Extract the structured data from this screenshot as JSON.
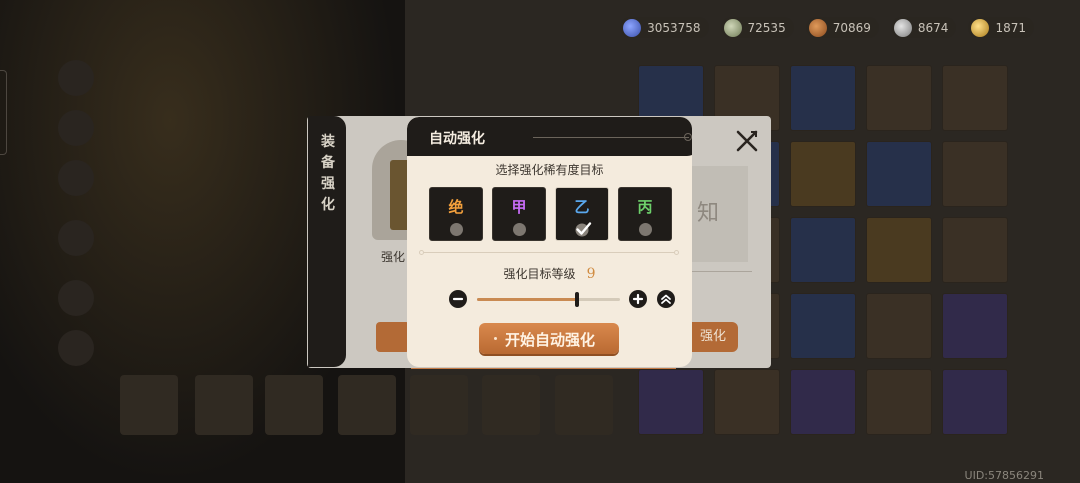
{
  "currencies": [
    {
      "icon": "blue-gem-icon",
      "value": "3053758"
    },
    {
      "icon": "green-leaf-icon",
      "value": "72535"
    },
    {
      "icon": "copper-ore-icon",
      "value": "70869"
    },
    {
      "icon": "silver-ore-icon",
      "value": "8674"
    },
    {
      "icon": "gold-coin-icon",
      "value": "1871"
    }
  ],
  "uid": "UID:57856291",
  "parent_dialog": {
    "tab_title": "装备强化",
    "left_label": "强化",
    "unknown_text": "知",
    "right_button": "强化"
  },
  "auto_dialog": {
    "title": "自动强化",
    "subtitle": "选择强化稀有度目标",
    "rarities": [
      {
        "name": "绝",
        "color": "#f3a03c",
        "selected": false
      },
      {
        "name": "甲",
        "color": "#c66bf5",
        "selected": false
      },
      {
        "name": "乙",
        "color": "#5aa8ee",
        "selected": true
      },
      {
        "name": "丙",
        "color": "#6dd06b",
        "selected": false
      }
    ],
    "level_label": "强化目标等级",
    "level_value": "9",
    "slider_fraction": 0.7,
    "start_button": "开始自动强化"
  }
}
